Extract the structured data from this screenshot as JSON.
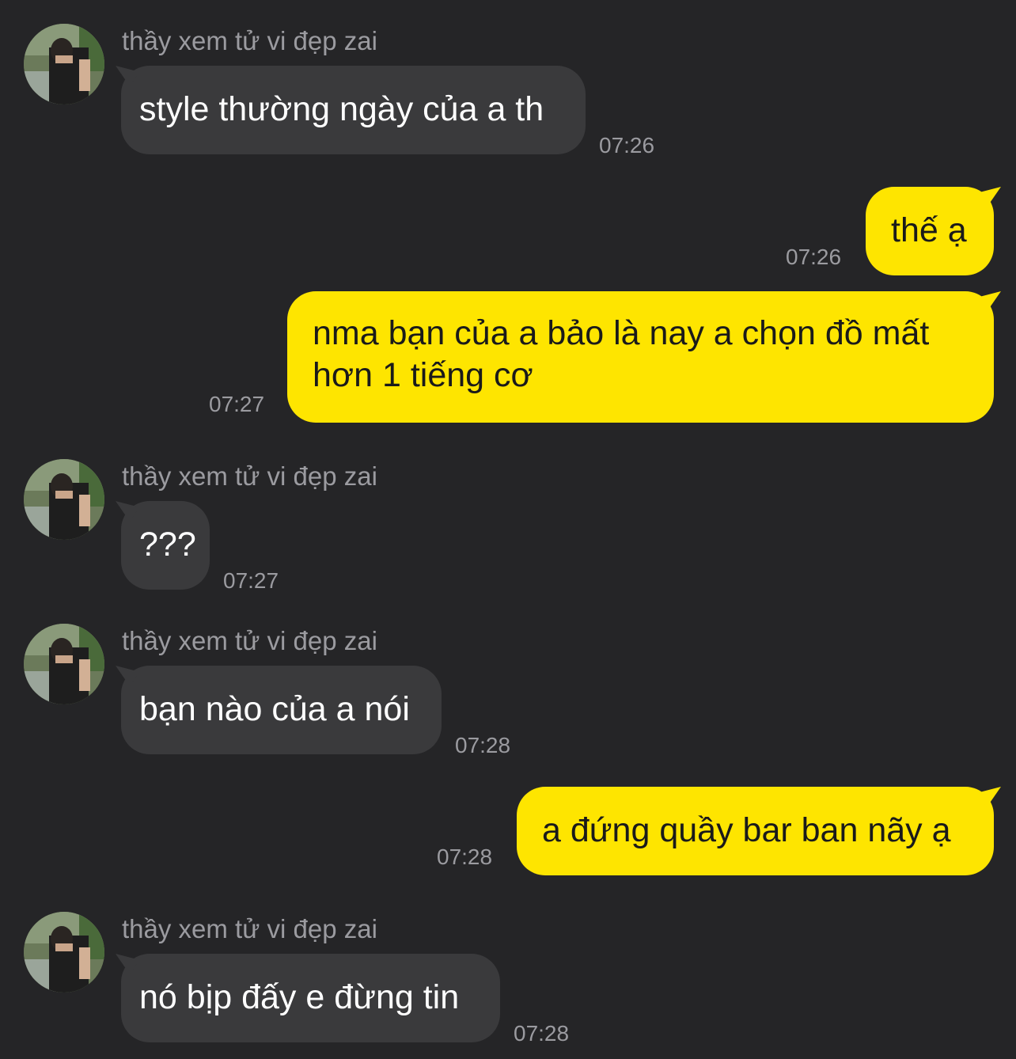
{
  "chat": {
    "messages": [
      {
        "direction": "incoming",
        "sender": "thầy xem tử vi đẹp zai",
        "text": "style thường ngày của a th",
        "time": "07:26"
      },
      {
        "direction": "outgoing",
        "text": "thế ạ",
        "time": "07:26"
      },
      {
        "direction": "outgoing",
        "text": "nma bạn của a bảo là nay a chọn đồ mất hơn 1 tiếng cơ",
        "time": "07:27"
      },
      {
        "direction": "incoming",
        "sender": "thầy xem tử vi đẹp zai",
        "text": "???",
        "time": "07:27"
      },
      {
        "direction": "incoming",
        "sender": "thầy xem tử vi đẹp zai",
        "text": "bạn nào của a nói",
        "time": "07:28"
      },
      {
        "direction": "outgoing",
        "text": "a đứng quầy bar ban nãy ạ",
        "time": "07:28"
      },
      {
        "direction": "incoming",
        "sender": "thầy xem tử vi đẹp zai",
        "text": "nó bịp đấy e đừng tin",
        "time": "07:28"
      }
    ]
  },
  "colors": {
    "background": "#252527",
    "incoming_bubble": "#3a3a3c",
    "outgoing_bubble": "#fee500",
    "meta_text": "#9b9ba0"
  }
}
